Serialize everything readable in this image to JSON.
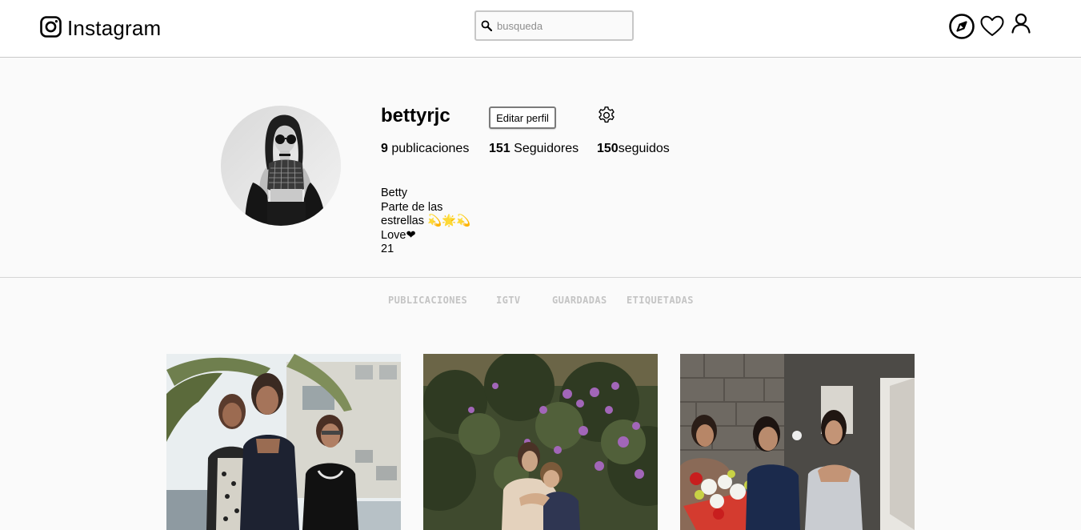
{
  "topbar": {
    "logo_text": "Instagram",
    "search_placeholder": "busqueda",
    "icons": [
      "instagram-logo-icon",
      "search-icon",
      "explore-compass-icon",
      "heart-icon",
      "user-profile-icon"
    ]
  },
  "profile": {
    "username": "bettyrjc",
    "edit_button_label": "Editar perfil",
    "settings_icon": "gear-icon",
    "stats": {
      "posts_count": "9",
      "posts_label": "publicaciones",
      "followers_count": "151",
      "followers_label": "Seguidores",
      "following_count": "150",
      "following_label": "seguidos"
    },
    "bio_lines": [
      "Betty",
      "Parte de las",
      "estrellas 💫🌟💫",
      "Love❤",
      "21"
    ]
  },
  "tabs": [
    "PUBLICACIONES",
    "IGTV",
    "GUARDADAS",
    "ETIQUETADAS"
  ],
  "posts": [
    {
      "name": "post-photo-1"
    },
    {
      "name": "post-photo-2"
    },
    {
      "name": "post-photo-3"
    }
  ]
}
